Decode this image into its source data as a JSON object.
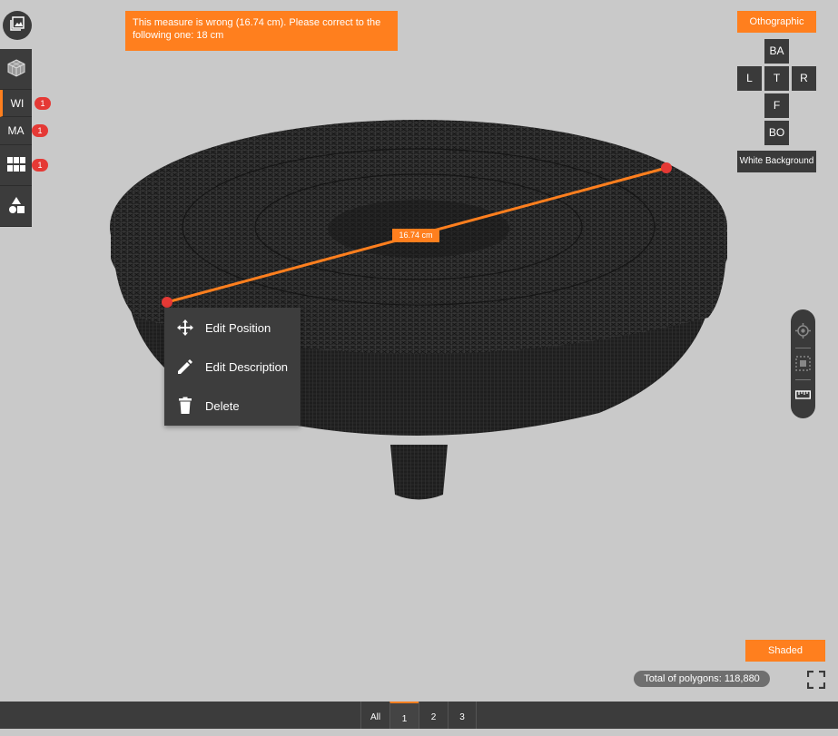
{
  "warning": {
    "text": "This measure is wrong (16.74 cm). Please correct to the following one: 18 cm"
  },
  "measurement": {
    "label": "16.74 cm"
  },
  "left_toolbar": {
    "items": [
      {
        "label": "",
        "icon": "cube-icon",
        "badge": ""
      },
      {
        "label": "WI",
        "icon": "",
        "badge": "1"
      },
      {
        "label": "MA",
        "icon": "",
        "badge": "1"
      },
      {
        "label": "",
        "icon": "grid-icon",
        "badge": "1"
      },
      {
        "label": "",
        "icon": "shapes-icon",
        "badge": ""
      }
    ]
  },
  "view_controls": {
    "projection_label": "Othographic",
    "views": {
      "back": "BA",
      "left": "L",
      "top": "T",
      "right": "R",
      "front": "F",
      "bottom": "BO"
    },
    "background_label": "White Background"
  },
  "context_menu": {
    "items": [
      {
        "label": "Edit Position",
        "icon": "move-icon"
      },
      {
        "label": "Edit Description",
        "icon": "pencil-icon"
      },
      {
        "label": "Delete",
        "icon": "trash-icon"
      }
    ]
  },
  "render_mode": {
    "label": "Shaded"
  },
  "stats": {
    "polygons": "Total of polygons: 118,880"
  },
  "bottom_tabs": [
    "All",
    "1",
    "2",
    "3"
  ],
  "colors": {
    "accent": "#ff7f1e",
    "panel": "#3a3a3a",
    "badge": "#e53935",
    "background": "#c9c9c9"
  }
}
